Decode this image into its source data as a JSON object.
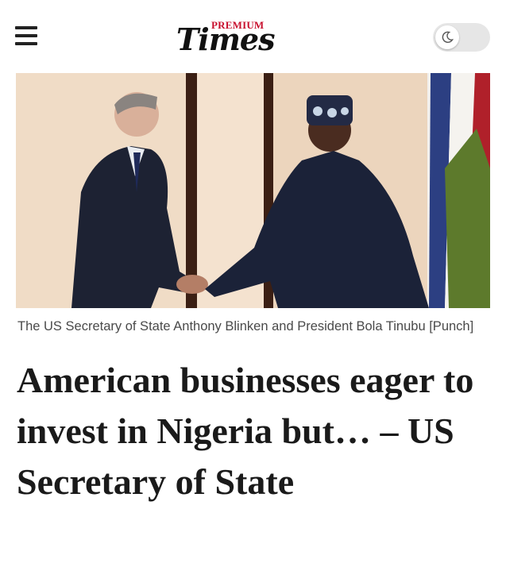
{
  "header": {
    "menu_icon": "hamburger-menu-icon",
    "logo": {
      "premium": "PREMIUM",
      "times": "Times"
    },
    "theme_toggle": {
      "icon": "moon-icon",
      "state": "light"
    }
  },
  "article": {
    "image_caption": "The US Secretary of State Anthony Blinken and President Bola Tinubu [Punch]",
    "headline": "American businesses eager to invest in Nigeria but… – US Secretary of State"
  },
  "colors": {
    "brand_red": "#c8102e",
    "text_dark": "#1a1a1a",
    "caption_gray": "#4a4a4a"
  }
}
